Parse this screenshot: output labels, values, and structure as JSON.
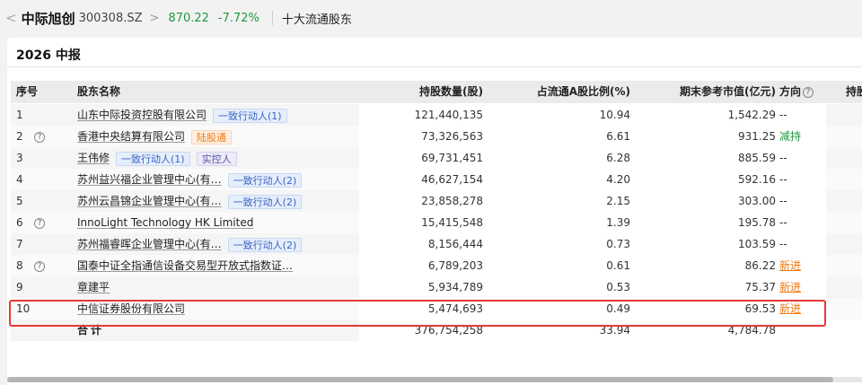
{
  "header": {
    "back_glyph": "<",
    "stock_name": "中际旭创",
    "stock_code": "300308.SZ",
    "chevron_glyph": ">",
    "price": "870.22",
    "change": "-7.72%",
    "subtitle": "十大流通股东"
  },
  "card": {
    "title": "2026 中报"
  },
  "table": {
    "columns": {
      "idx": "序号",
      "name": "股东名称",
      "shares": "持股数量(股)",
      "ratio": "占流通A股比例(%)",
      "value": "期末参考市值(亿元)",
      "direction": "方向",
      "next": "持股"
    },
    "rows": [
      {
        "idx": "1",
        "q": "",
        "name": "山东中际投资控股有限公司",
        "tag": "一致行动人(1)",
        "tag2": "",
        "shares": "121,440,135",
        "ratio": "10.94",
        "value": "1,542.29",
        "dir": "--"
      },
      {
        "idx": "2",
        "q": "?",
        "name": "香港中央结算有限公司",
        "tag": "陆股通",
        "tag2": "",
        "shares": "73,326,563",
        "ratio": "6.61",
        "value": "931.25",
        "dir": "减持"
      },
      {
        "idx": "3",
        "q": "",
        "name": "王伟修",
        "tag": "一致行动人(1)",
        "tag2": "实控人",
        "shares": "69,731,451",
        "ratio": "6.28",
        "value": "885.59",
        "dir": "--"
      },
      {
        "idx": "4",
        "q": "",
        "name": "苏州益兴福企业管理中心(有…",
        "tag": "一致行动人(2)",
        "tag2": "",
        "shares": "46,627,154",
        "ratio": "4.20",
        "value": "592.16",
        "dir": "--"
      },
      {
        "idx": "5",
        "q": "",
        "name": "苏州云昌锦企业管理中心(有…",
        "tag": "一致行动人(2)",
        "tag2": "",
        "shares": "23,858,278",
        "ratio": "2.15",
        "value": "303.00",
        "dir": "--"
      },
      {
        "idx": "6",
        "q": "?",
        "name": "InnoLight Technology HK Limited",
        "tag": "",
        "tag2": "",
        "shares": "15,415,548",
        "ratio": "1.39",
        "value": "195.78",
        "dir": "--"
      },
      {
        "idx": "7",
        "q": "",
        "name": "苏州福睿晖企业管理中心(有…",
        "tag": "一致行动人(2)",
        "tag2": "",
        "shares": "8,156,444",
        "ratio": "0.73",
        "value": "103.59",
        "dir": "--"
      },
      {
        "idx": "8",
        "q": "?",
        "name": "国泰中证全指通信设备交易型开放式指数证…",
        "tag": "",
        "tag2": "",
        "shares": "6,789,203",
        "ratio": "0.61",
        "value": "86.22",
        "dir": "新进"
      },
      {
        "idx": "9",
        "q": "",
        "name": "章建平",
        "tag": "",
        "tag2": "",
        "shares": "5,934,789",
        "ratio": "0.53",
        "value": "75.37",
        "dir": "新进"
      },
      {
        "idx": "10",
        "q": "",
        "name": "中信证券股份有限公司",
        "tag": "",
        "tag2": "",
        "shares": "5,474,693",
        "ratio": "0.49",
        "value": "69.53",
        "dir": "新进"
      }
    ],
    "total": {
      "label": "合计",
      "shares": "376,754,258",
      "ratio": "33.94",
      "value": "4,784.78"
    }
  },
  "colors": {
    "down_green": "#1e9a3e",
    "new_orange": "#f07b14",
    "highlight_red": "#e53935",
    "tag_blue": "#3a63c7"
  },
  "icons": {
    "back": "chevron-left-icon",
    "breadcrumb": "chevron-right-icon",
    "help": "question-circle-icon"
  }
}
